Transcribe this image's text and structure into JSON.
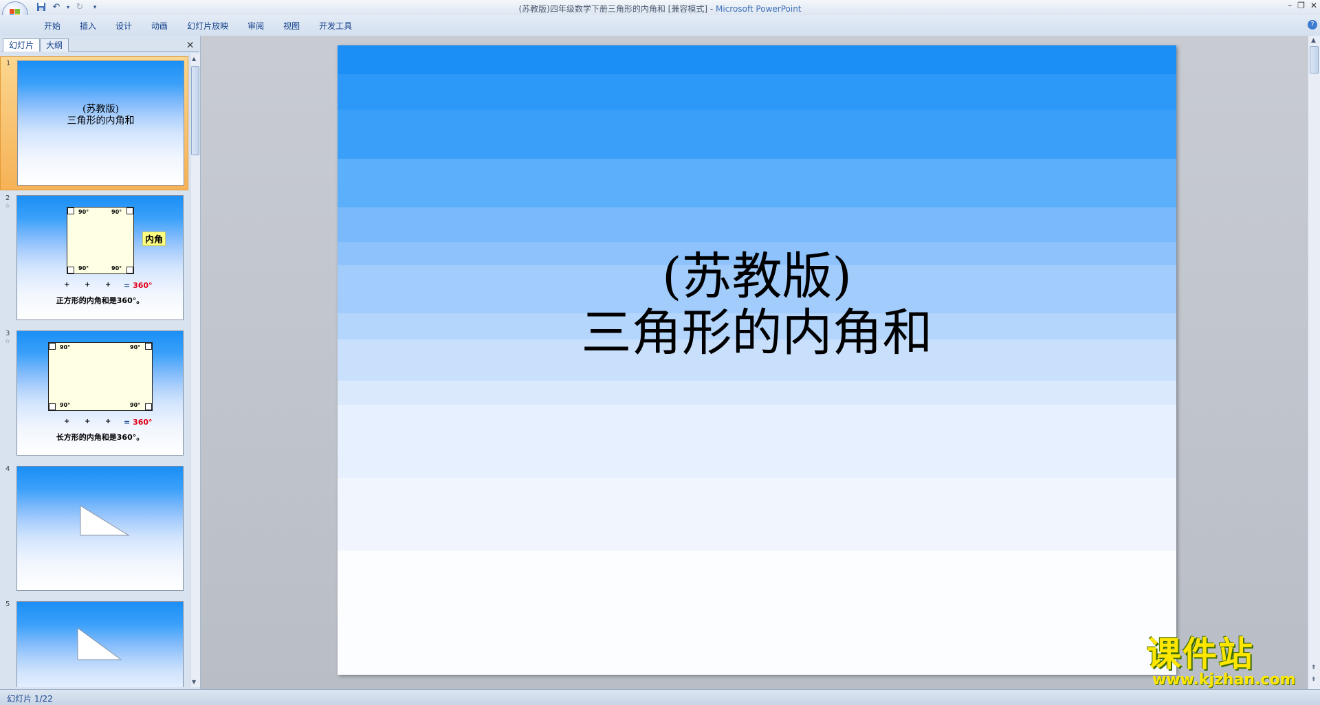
{
  "window": {
    "title": "(苏教版)四年级数学下册三角形的内角和 [兼容模式]",
    "title_sep": " - ",
    "app_name": "Microsoft PowerPoint"
  },
  "ribbon": {
    "tabs": [
      "开始",
      "插入",
      "设计",
      "动画",
      "幻灯片放映",
      "审阅",
      "视图",
      "开发工具"
    ]
  },
  "panel": {
    "tab_slides": "幻灯片",
    "tab_outline": "大纲",
    "close_glyph": "×"
  },
  "thumbnails": [
    {
      "number": "1",
      "line1": "(苏教版)",
      "line2": "三角形的内角和"
    },
    {
      "number": "2",
      "deg_tl": "90°",
      "deg_tr": "90°",
      "deg_bl": "90°",
      "deg_br": "90°",
      "eq": "=",
      "sum": "360°",
      "badge": "内角",
      "caption": "正方形的内角和是360°。"
    },
    {
      "number": "3",
      "deg_tl": "90°",
      "deg_tr": "90°",
      "deg_bl": "90°",
      "deg_br": "90°",
      "eq": "=",
      "sum": "360°",
      "caption": "长方形的内角和是360°。"
    },
    {
      "number": "4"
    },
    {
      "number": "5"
    }
  ],
  "slide": {
    "line1": "(苏教版)",
    "line2": "三角形的内角和"
  },
  "status": {
    "text": "幻灯片 1/22"
  },
  "watermark": {
    "cn": "课件站",
    "url": "www.kjzhan.com"
  },
  "colors": {
    "accent": "#15428b",
    "slide_top": "#1b8ff5",
    "selected_thumb": "#f6b256",
    "sum_red": "#e4001a",
    "watermark": "#ffe600"
  }
}
